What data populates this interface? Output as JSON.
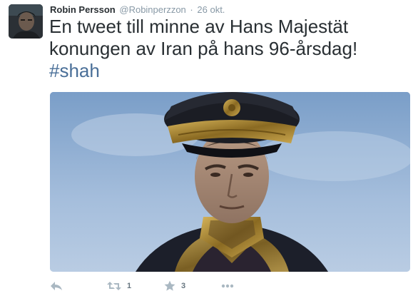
{
  "tweet": {
    "display_name": "Robin Persson",
    "username": "@Robinperzzon",
    "separator": "·",
    "timestamp": "26 okt.",
    "text": "En tweet till minne av Hans Majestät konungen av Iran på hans 96-årsdag!",
    "hashtag": "#shah"
  },
  "actions": {
    "reply_icon": "reply-icon",
    "retweet_icon": "retweet-icon",
    "retweet_count": "1",
    "favorite_icon": "star-icon",
    "favorite_count": "3",
    "more_icon": "more-icon"
  },
  "colors": {
    "text": "#292f33",
    "muted": "#8899a6",
    "hashtag": "#4a6f98",
    "action_icon": "#aab8c2"
  }
}
